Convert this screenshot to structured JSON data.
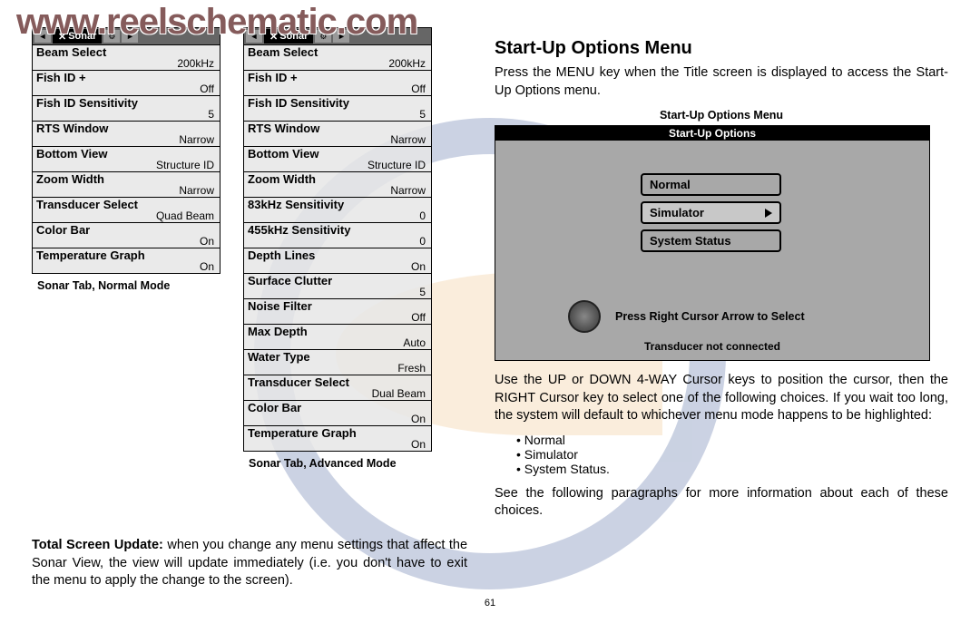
{
  "watermark": "www.reelschematic.com",
  "page_number": "61",
  "sonar_tab_label": "Sonar",
  "menu_normal": {
    "caption": "Sonar Tab, Normal Mode",
    "rows": [
      {
        "label": "Beam Select",
        "value": "200kHz"
      },
      {
        "label": "Fish ID +",
        "value": "Off"
      },
      {
        "label": "Fish ID Sensitivity",
        "value": "5"
      },
      {
        "label": "RTS Window",
        "value": "Narrow"
      },
      {
        "label": "Bottom View",
        "value": "Structure ID"
      },
      {
        "label": "Zoom Width",
        "value": "Narrow"
      },
      {
        "label": "Transducer Select",
        "value": "Quad Beam"
      },
      {
        "label": "Color Bar",
        "value": "On"
      },
      {
        "label": "Temperature Graph",
        "value": "On"
      }
    ]
  },
  "menu_advanced": {
    "caption": "Sonar Tab, Advanced Mode",
    "rows": [
      {
        "label": "Beam Select",
        "value": "200kHz"
      },
      {
        "label": "Fish ID +",
        "value": "Off"
      },
      {
        "label": "Fish ID Sensitivity",
        "value": "5"
      },
      {
        "label": "RTS Window",
        "value": "Narrow"
      },
      {
        "label": "Bottom View",
        "value": "Structure ID"
      },
      {
        "label": "Zoom Width",
        "value": "Narrow"
      },
      {
        "label": "83kHz Sensitivity",
        "value": "0"
      },
      {
        "label": "455kHz Sensitivity",
        "value": "0"
      },
      {
        "label": "Depth Lines",
        "value": "On"
      },
      {
        "label": "Surface Clutter",
        "value": "5"
      },
      {
        "label": "Noise Filter",
        "value": "Off"
      },
      {
        "label": "Max Depth",
        "value": "Auto"
      },
      {
        "label": "Water Type",
        "value": "Fresh"
      },
      {
        "label": "Transducer Select",
        "value": "Dual Beam"
      },
      {
        "label": "Color Bar",
        "value": "On"
      },
      {
        "label": "Temperature Graph",
        "value": "On"
      }
    ]
  },
  "total_screen": {
    "label": "Total Screen Update:",
    "text": " when you change any menu settings that affect the Sonar View, the view will update immediately (i.e. you don't have to exit the menu to apply the change to the screen)."
  },
  "right": {
    "heading": "Start-Up Options Menu",
    "intro": "Press the MENU key when the Title screen is displayed to access the Start-Up Options menu.",
    "caption": "Start-Up Options Menu",
    "shot_title": "Start-Up Options",
    "options": [
      "Normal",
      "Simulator",
      "System Status"
    ],
    "selected_index": 1,
    "hint": "Press Right Cursor Arrow to Select",
    "xducer": "Transducer not connected",
    "para2": "Use the UP or DOWN 4-WAY Cursor keys to position the cursor, then the RIGHT Cursor key to select one of the following choices. If you wait too long, the system will default to whichever menu mode happens to be highlighted:",
    "bullets": [
      "Normal",
      "Simulator",
      "System Status."
    ],
    "para3": "See the following paragraphs for more information about each of these choices."
  }
}
